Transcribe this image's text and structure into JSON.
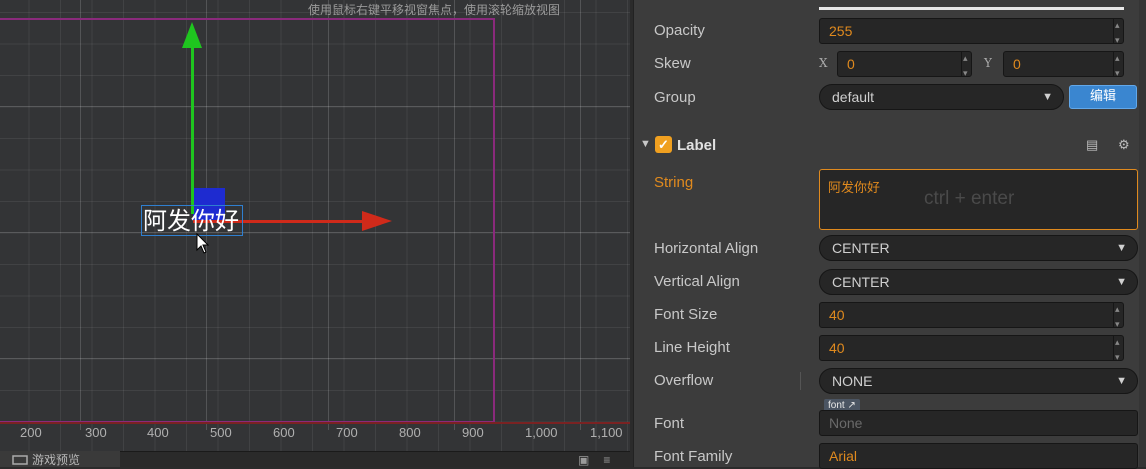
{
  "scene": {
    "hint": "使用鼠标右键平移视窗焦点，使用滚轮缩放视图",
    "node_label": "阿发你好",
    "ruler": [
      "200",
      "300",
      "400",
      "500",
      "600",
      "700",
      "800",
      "900",
      "1,000",
      "1,100"
    ],
    "preview_tab": "游戏预览"
  },
  "inspector": {
    "opacity": {
      "label": "Opacity",
      "value": "255"
    },
    "skew": {
      "label": "Skew",
      "x_label": "X",
      "x_value": "0",
      "y_label": "Y",
      "y_value": "0"
    },
    "group": {
      "label": "Group",
      "value": "default",
      "edit_button": "编辑"
    },
    "label_component": {
      "title": "Label",
      "enabled": true,
      "string": {
        "label": "String",
        "value": "阿发你好",
        "placeholder": "ctrl + enter"
      },
      "horizontal_align": {
        "label": "Horizontal Align",
        "value": "CENTER"
      },
      "vertical_align": {
        "label": "Vertical Align",
        "value": "CENTER"
      },
      "font_size": {
        "label": "Font Size",
        "value": "40"
      },
      "line_height": {
        "label": "Line Height",
        "value": "40"
      },
      "overflow": {
        "label": "Overflow",
        "value": "NONE"
      },
      "font": {
        "label": "Font",
        "tag": "font",
        "value": "None"
      },
      "font_family": {
        "label": "Font Family",
        "value": "Arial"
      }
    }
  },
  "colors": {
    "accent": "#e08a1e",
    "x_axis": "#d02a1a",
    "y_axis": "#1fc51f",
    "button": "#3a86d0"
  }
}
